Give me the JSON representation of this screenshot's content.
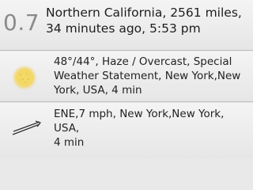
{
  "earthquake": {
    "magnitude": "0.7",
    "line1": "Northern California, 2561 miles,",
    "line2": "34 minutes ago, 5:53 pm"
  },
  "weather": {
    "icon": "hazy-sun-icon",
    "line1": "48°/44°, Haze / Overcast, Special",
    "line2": "Weather Statement, New York,New",
    "line3": "York, USA, 4 min"
  },
  "wind": {
    "icon": "wind-arrow-icon",
    "line1": "ENE,7 mph, New York,New York, USA,",
    "line2": "4 min"
  }
}
